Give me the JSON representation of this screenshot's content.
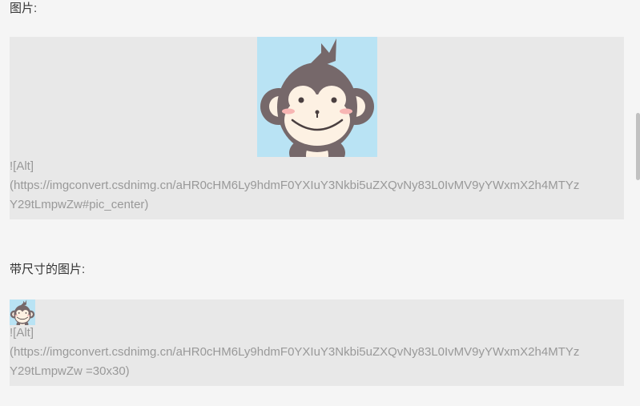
{
  "sections": [
    {
      "label": "图片:",
      "markdown_line1": "![Alt]",
      "markdown_line2": "(https://imgconvert.csdnimg.cn/aHR0cHM6Ly9hdmF0YXIuY3Nkbi5uZXQvNy83L0IvMV9yYWxmX2h4MTYz",
      "markdown_line3": "Y29tLmpwZw#pic_center)",
      "image_icon": "monkey-avatar-icon"
    },
    {
      "label": "带尺寸的图片:",
      "markdown_line1": "![Alt]",
      "markdown_line2": "(https://imgconvert.csdnimg.cn/aHR0cHM6Ly9hdmF0YXIuY3Nkbi5uZXQvNy83L0IvMV9yYWxmX2h4MTYz",
      "markdown_line3": "Y29tLmpwZw =30x30)",
      "image_icon": "monkey-avatar-icon"
    }
  ],
  "colors": {
    "background": "#f5f5f5",
    "block": "#e8e8e8",
    "image_bg": "#b9e3f4",
    "fur": "#76686a",
    "face": "#fdf1e3",
    "muted_text": "#999999"
  }
}
